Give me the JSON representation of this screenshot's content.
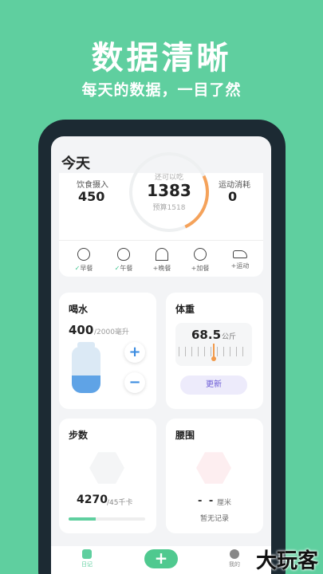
{
  "hero": {
    "title": "数据清晰",
    "subtitle": "每天的数据，一目了然"
  },
  "screen": {
    "title": "今天"
  },
  "summary": {
    "intake_label": "饮食摄入",
    "intake_value": "450",
    "remaining_label": "还可以吃",
    "remaining_value": "1383",
    "budget_label": "预算1518",
    "burn_label": "运动消耗",
    "burn_value": "0"
  },
  "meals": [
    {
      "icon": "egg-icon",
      "prefix": "✓",
      "label": "早餐"
    },
    {
      "icon": "bowl-icon",
      "prefix": "✓",
      "label": "午餐"
    },
    {
      "icon": "cloche-icon",
      "prefix": "+",
      "label": "晚餐"
    },
    {
      "icon": "apple-icon",
      "prefix": "+",
      "label": "加餐"
    },
    {
      "icon": "shoe-icon",
      "prefix": "+",
      "label": "运动"
    }
  ],
  "water": {
    "title": "喝水",
    "amount": "400",
    "goal": "/2000毫升",
    "plus": "+",
    "minus": "−",
    "fill_fraction": 0.2
  },
  "weight": {
    "title": "体重",
    "value": "68.5",
    "unit": "公斤",
    "update_label": "更新"
  },
  "steps": {
    "title": "步数",
    "value": "4270",
    "goal": "/45千卡",
    "progress": 0.35
  },
  "waist": {
    "title": "腰围",
    "value": "- -",
    "unit": "厘米",
    "status": "暂无记录"
  },
  "tabbar": {
    "diary_label": "日记",
    "add_label": "+",
    "mine_label": "我的"
  },
  "watermark": "大玩客",
  "colors": {
    "background": "#5fcf9f",
    "accent_green": "#4fc98f",
    "water_blue": "#5fa3e6",
    "weight_needle": "#f29a4a",
    "update_purple": "#6b5bd6"
  }
}
